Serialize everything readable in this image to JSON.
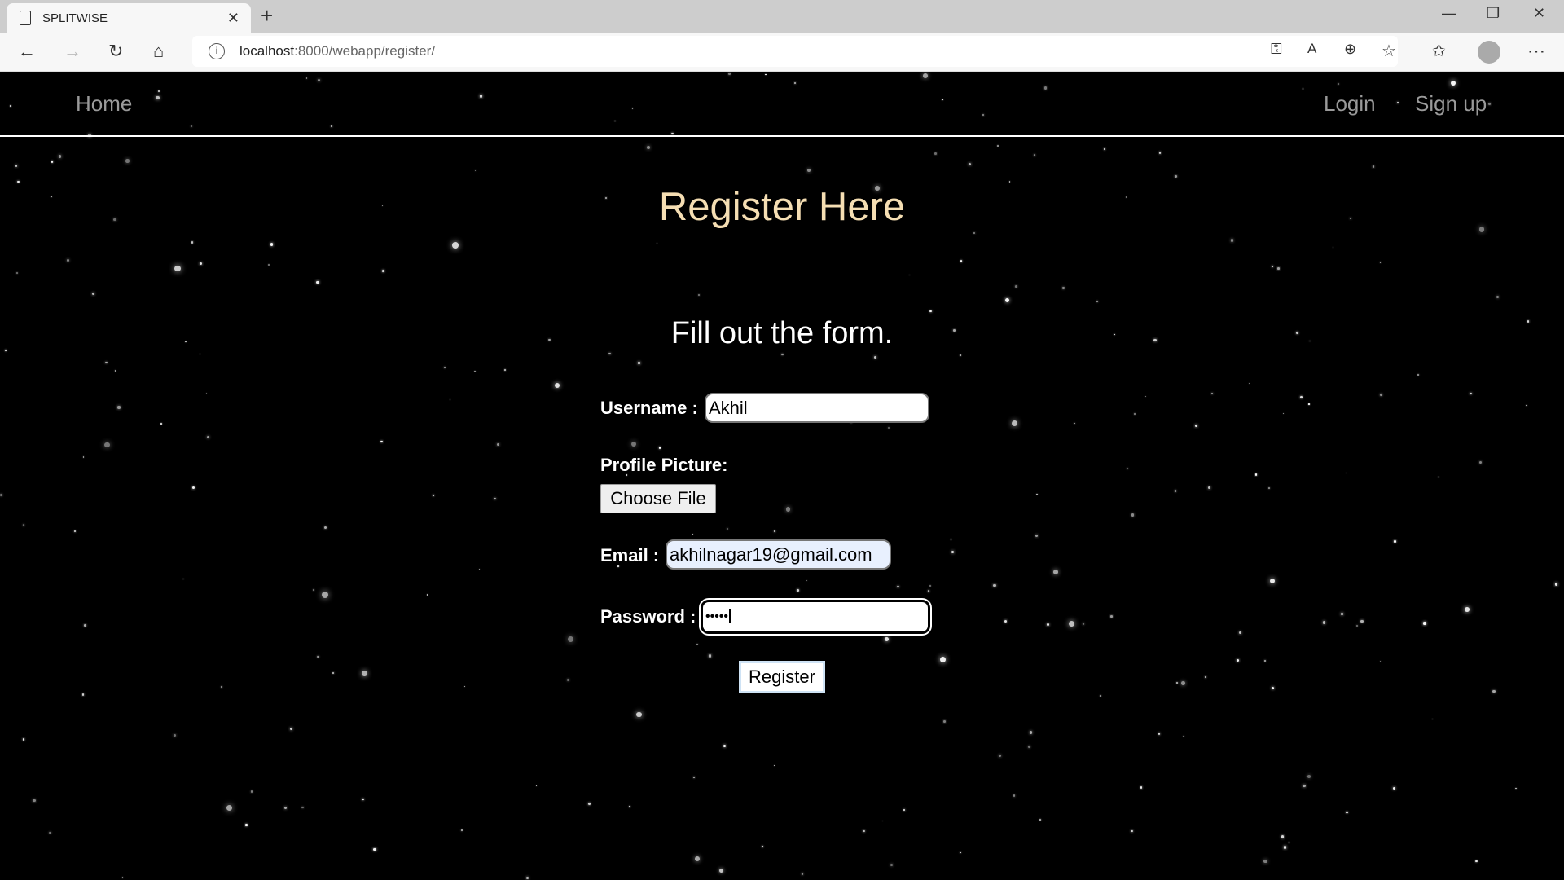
{
  "browser": {
    "tab_title": "SPLITWISE",
    "url_host": "localhost",
    "url_path": ":8000/webapp/register/"
  },
  "nav": {
    "home": "Home",
    "login": "Login",
    "signup": "Sign up"
  },
  "page": {
    "title": "Register Here",
    "subtitle": "Fill out the form."
  },
  "form": {
    "username_label": "Username :",
    "username_value": "Akhil",
    "picture_label": "Profile Picture:",
    "choose_file": "Choose File",
    "email_label": "Email :",
    "email_value": "akhilnagar19@gmail.com",
    "password_label": "Password :",
    "password_value": "•••••",
    "submit": "Register"
  },
  "colors": {
    "title": "#f5deb3",
    "background": "#000000",
    "autofill": "#e8f0fe"
  }
}
